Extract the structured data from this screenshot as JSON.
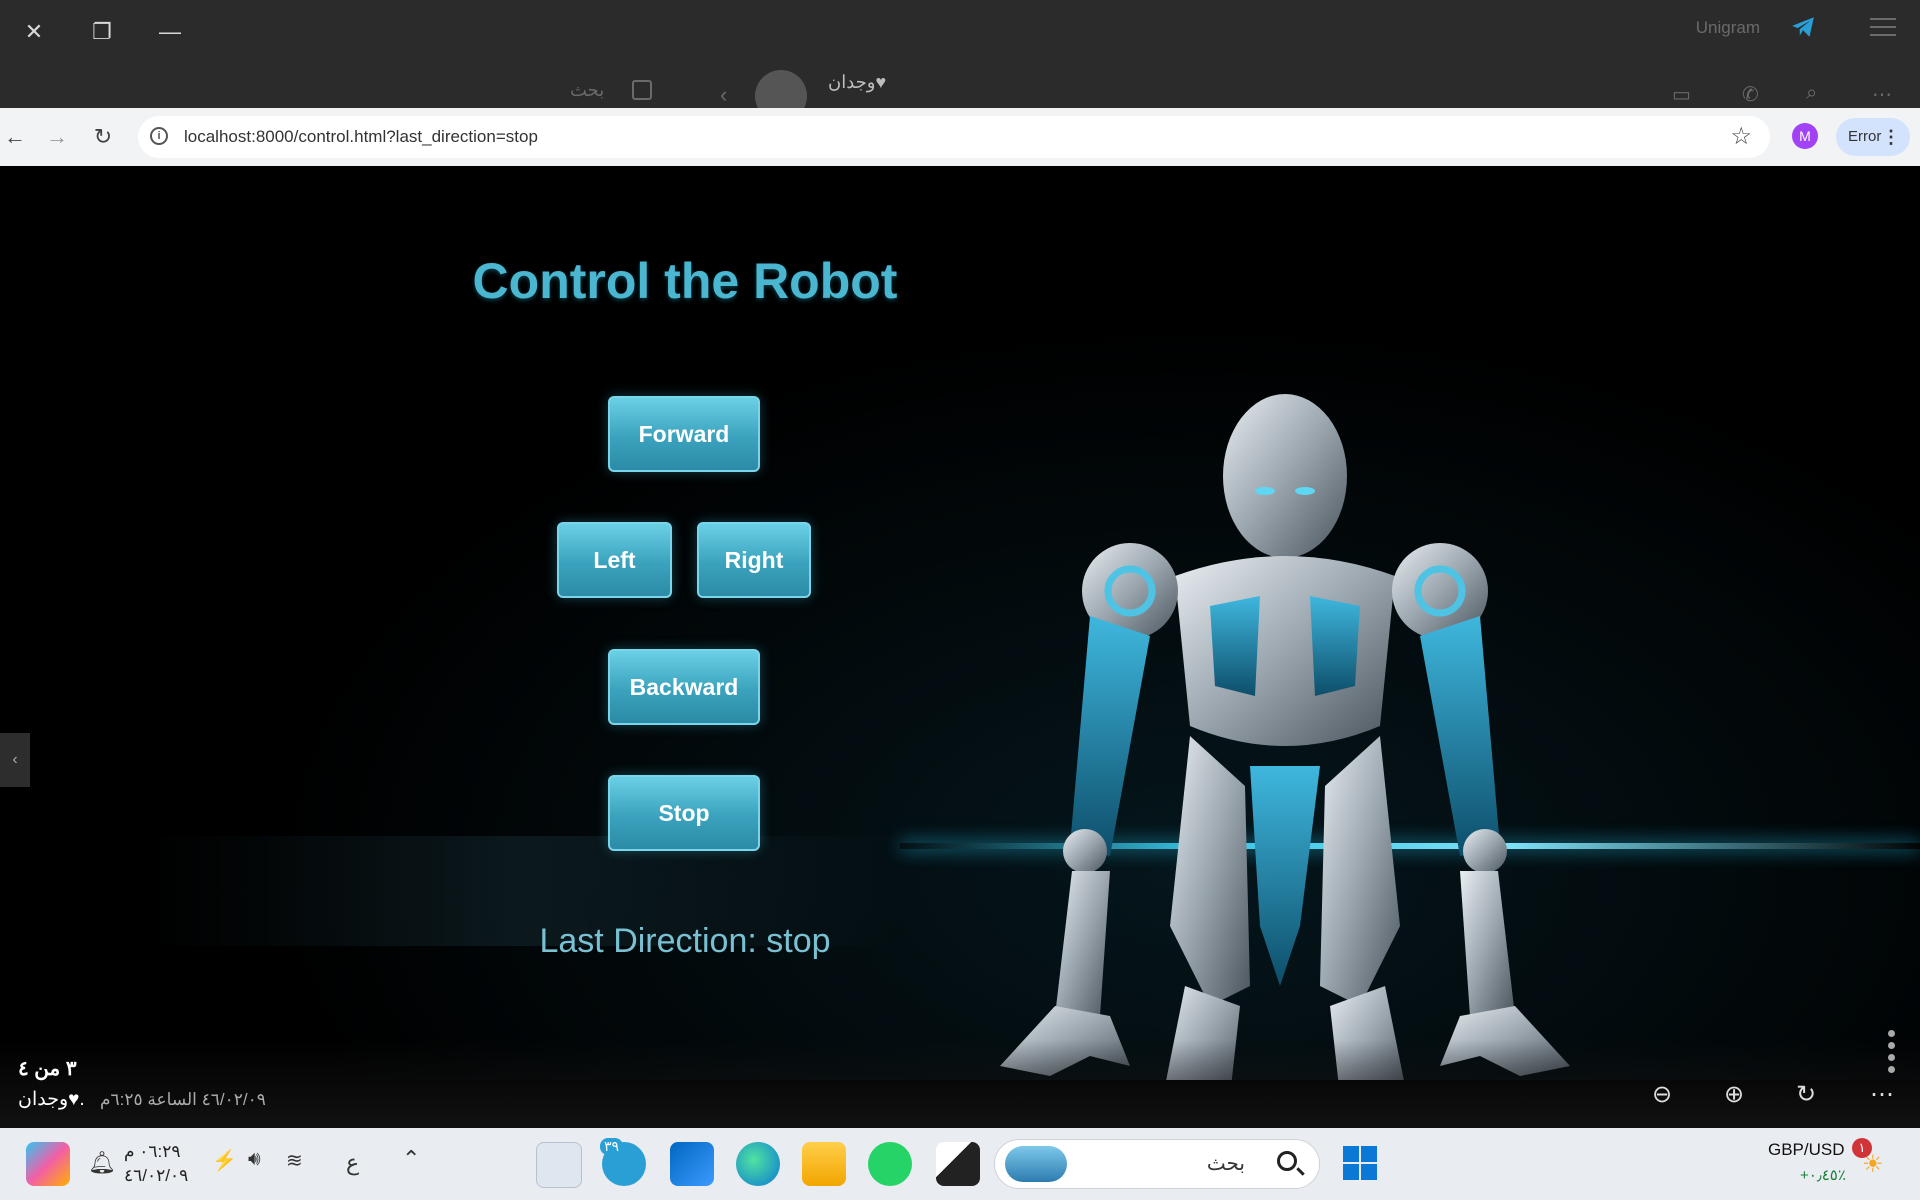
{
  "telegram": {
    "app_name": "Unigram",
    "search_label": "بحث",
    "chat_name": "وجدان♥"
  },
  "browser": {
    "url": "localhost:8000/control.html?last_direction=stop",
    "profile_initial": "M",
    "error_label": "Error"
  },
  "page": {
    "title": "Control the Robot",
    "buttons": {
      "forward": "Forward",
      "left": "Left",
      "right": "Right",
      "backward": "Backward",
      "stop": "Stop"
    },
    "last_direction_text": "Last Direction: stop"
  },
  "viewer": {
    "counter": "٣ من ٤",
    "sender": "وجدان♥.",
    "date": "٤٦/٠٢/٠٩ الساعة ٦:٢٥م"
  },
  "taskbar": {
    "time": "٠٦:٢٩ م",
    "date": "٤٦/٠٢/٠٩",
    "lang": "ع",
    "search_placeholder": "بحث",
    "telegram_badge": "٣٩",
    "fx_pair": "GBP/USD",
    "fx_change": "+٠٫٤٥٪",
    "notif_badge": "١"
  },
  "colors": {
    "accent_cyan": "#4ab6cf",
    "button_top": "#6ad0e6",
    "button_bottom": "#2c8ba6"
  }
}
